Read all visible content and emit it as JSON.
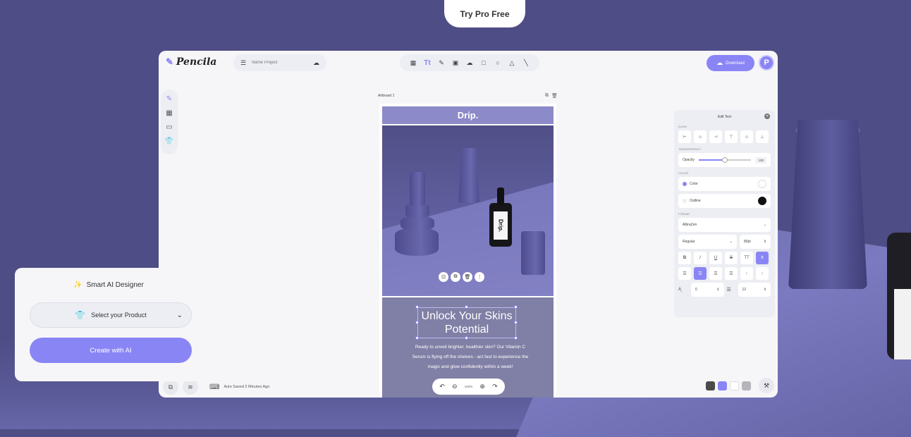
{
  "hero": {
    "try_pro_label": "Try Pro Free"
  },
  "app": {
    "logo_text": "Pencila",
    "project_placeholder": "Name Project",
    "download_label": "Download",
    "avatar_letter": "P",
    "autosave_text": "Auto Saved 2 Minutes Ago"
  },
  "toolbar": {
    "tools": [
      {
        "name": "layout-icon",
        "glyph": "▦"
      },
      {
        "name": "text-tool-icon",
        "glyph": "Tt"
      },
      {
        "name": "pen-tool-icon",
        "glyph": "✎"
      },
      {
        "name": "image-tool-icon",
        "glyph": "▣"
      },
      {
        "name": "upload-cloud-icon",
        "glyph": "☁"
      },
      {
        "name": "rectangle-tool-icon",
        "glyph": "□"
      },
      {
        "name": "circle-tool-icon",
        "glyph": "○"
      },
      {
        "name": "triangle-tool-icon",
        "glyph": "△"
      },
      {
        "name": "line-tool-icon",
        "glyph": "╲"
      }
    ]
  },
  "canvas": {
    "artboard_label": "Artboard 1",
    "brand_banner": "Drip.",
    "bottle_label": "Drip.",
    "headline": "Unlock Your Skins Potential",
    "body": "Ready to unveil brighter, healthier skin? Our Vitamin C Serum is flying off the shelves - act fast to experience the magic and glow confidently within a week!",
    "zoom": "100%"
  },
  "edit_panel": {
    "title": "Edit Text",
    "sections": {
      "align": "ALIGN",
      "transparency": "TRANSPARENCY",
      "color": "COLOR",
      "format": "FORMAT"
    },
    "opacity_label": "Opacity",
    "opacity_value": "100",
    "opacity_fraction": 0.5,
    "color_label": "Color",
    "outline_label": "Outline",
    "font_family": "AlbraZen",
    "font_weight": "Regular",
    "font_size": "80pt",
    "style_buttons": [
      "B",
      "I",
      "U",
      "S",
      "TT",
      "tt"
    ],
    "letter_spacing": "0",
    "line_height": "12"
  },
  "palette": [
    "#4a4a4a",
    "#8a85f5",
    "#ffffff",
    "#b5b5bc"
  ],
  "ai_card": {
    "title": "Smart AI Designer",
    "select_label": "Select your Product",
    "cta": "Create with AI"
  },
  "colors": {
    "accent": "#8a85f5",
    "background": "#4e4d85"
  }
}
